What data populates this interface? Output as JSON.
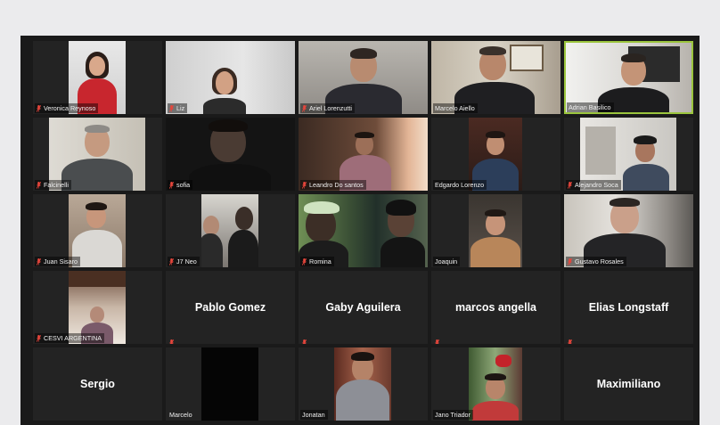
{
  "meeting": {
    "participants": [
      {
        "name": "Veronica Reynoso",
        "muted": true,
        "video": true
      },
      {
        "name": "Liz",
        "muted": true,
        "video": true
      },
      {
        "name": "Ariel Lorenzutti",
        "muted": true,
        "video": true
      },
      {
        "name": "Marcelo Aiello",
        "muted": false,
        "video": true
      },
      {
        "name": "Adrian Basilico",
        "muted": false,
        "video": true,
        "active_speaker": true
      },
      {
        "name": "Falcinelli",
        "muted": true,
        "video": true
      },
      {
        "name": "sofia",
        "muted": true,
        "video": true
      },
      {
        "name": "Leandro Do santos",
        "muted": true,
        "video": true
      },
      {
        "name": "Edgardo Lorenzo",
        "muted": false,
        "video": true
      },
      {
        "name": "Alejandro Soca",
        "muted": true,
        "video": true
      },
      {
        "name": "Juan Sisaro",
        "muted": true,
        "video": true
      },
      {
        "name": "J7 Neo",
        "muted": true,
        "video": true
      },
      {
        "name": "Romina",
        "muted": true,
        "video": true
      },
      {
        "name": "Joaquin",
        "muted": false,
        "video": true
      },
      {
        "name": "Gustavo Rosales",
        "muted": true,
        "video": true
      },
      {
        "name": "CESVI ARGENTINA",
        "muted": true,
        "video": true
      },
      {
        "name": "Pablo Gomez",
        "muted": true,
        "video": false
      },
      {
        "name": "Gaby Aguilera",
        "muted": true,
        "video": false
      },
      {
        "name": "marcos angella",
        "muted": true,
        "video": false
      },
      {
        "name": "Elias Longstaff",
        "muted": true,
        "video": false
      },
      {
        "name": "Sergio",
        "muted": false,
        "video": false
      },
      {
        "name": "Marcelo",
        "muted": false,
        "video": true
      },
      {
        "name": "Jonatan",
        "muted": false,
        "video": true
      },
      {
        "name": "Jano Triador",
        "muted": false,
        "video": true
      },
      {
        "name": "Maximiliano",
        "muted": false,
        "video": false
      }
    ]
  },
  "colors": {
    "background": "#ebebed",
    "grid": "#1a1a1a",
    "tile": "#232323",
    "active_speaker_border": "#9bc53d",
    "muted_icon": "#e8463c",
    "name_text": "#f2f2f2"
  },
  "icons": {
    "muted": "microphone-muted-icon"
  }
}
